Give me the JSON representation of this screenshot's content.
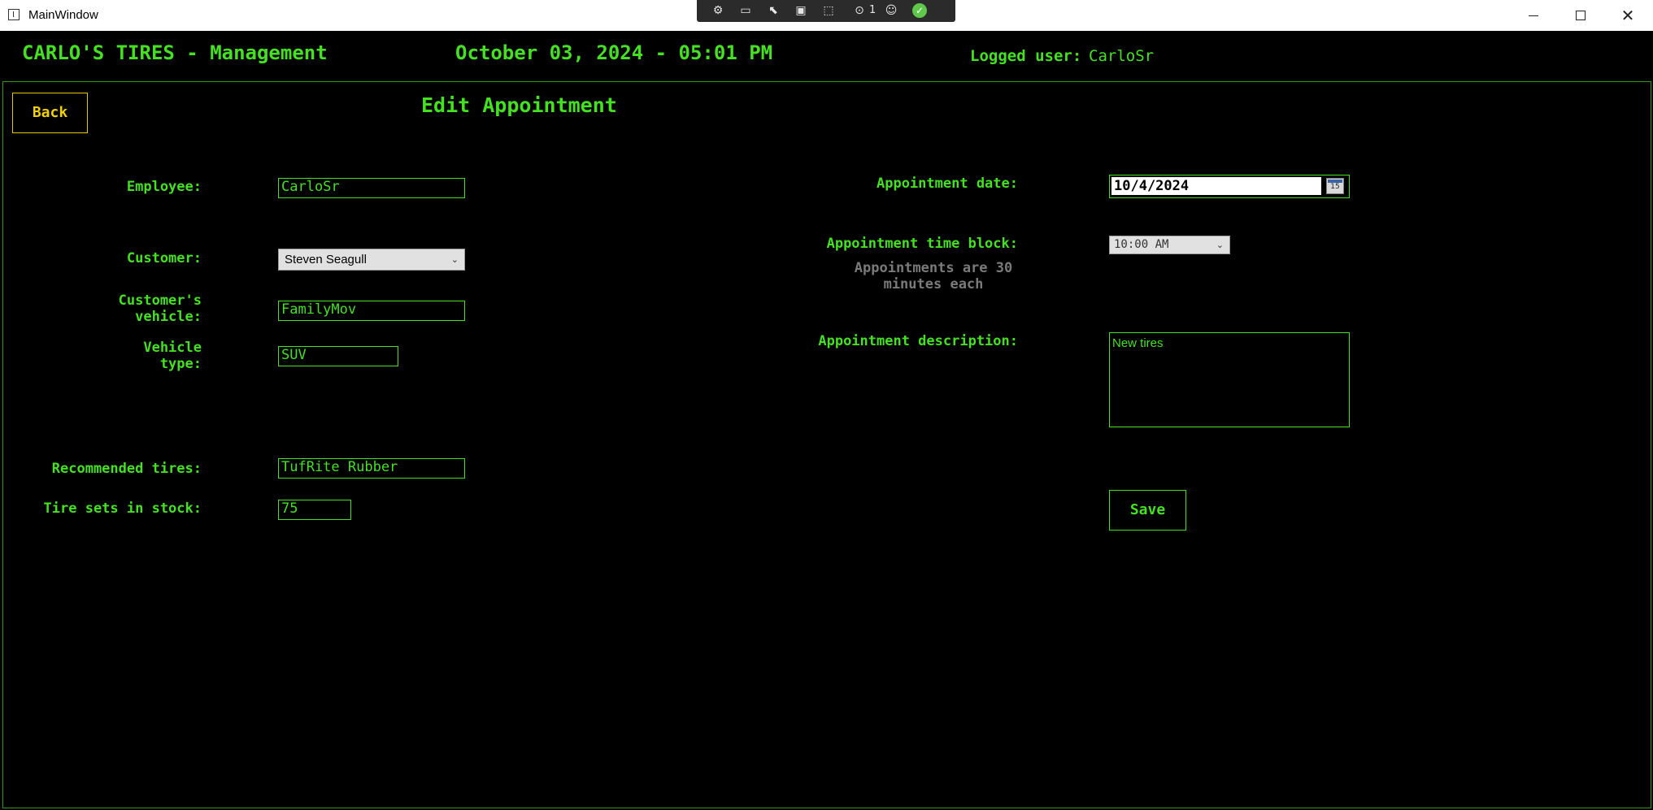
{
  "window": {
    "title": "MainWindow",
    "devtools": {
      "issue_count": "1"
    }
  },
  "header": {
    "app_title": "CARLO'S TIRES - Management",
    "datetime": "October 03, 2024 - 05:01 PM",
    "logged_user_label": "Logged user:",
    "logged_user": "CarloSr"
  },
  "page": {
    "back_label": "Back",
    "title": "Edit Appointment",
    "save_label": "Save"
  },
  "form": {
    "employee": {
      "label": "Employee:",
      "value": "CarloSr"
    },
    "customer": {
      "label": "Customer:",
      "value": "Steven Seagull"
    },
    "vehicle": {
      "label_line1": "Customer's",
      "label_line2": "vehicle:",
      "value": "FamilyMov"
    },
    "vehicle_type": {
      "label_line1": "Vehicle",
      "label_line2": "type:",
      "value": "SUV"
    },
    "recommended_tires": {
      "label": "Recommended tires:",
      "value": "TufRite Rubber"
    },
    "tire_stock": {
      "label": "Tire sets in stock:",
      "value": "75"
    },
    "appointment_date": {
      "label": "Appointment date:",
      "value": "10/4/2024",
      "calendar_icon_day": "15"
    },
    "time_block": {
      "label": "Appointment time block:",
      "value": "10:00 AM",
      "note_line1": "Appointments are 30",
      "note_line2": "minutes each"
    },
    "description": {
      "label": "Appointment description:",
      "value": "New tires"
    }
  },
  "colors": {
    "accent": "#45e022",
    "back_button": "#f0d000",
    "background": "#000000",
    "muted_text": "#7a7a7a"
  }
}
